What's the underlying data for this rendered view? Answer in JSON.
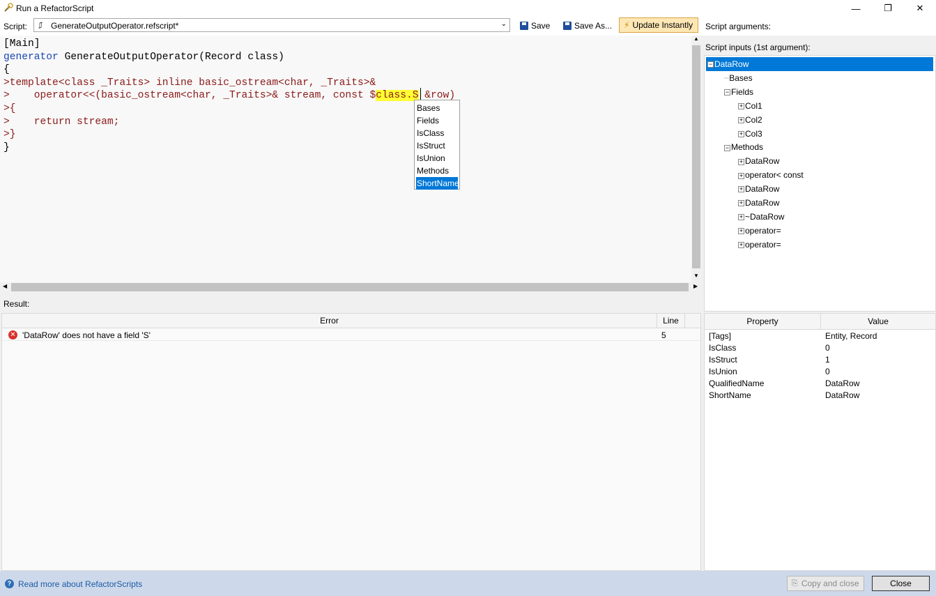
{
  "window": {
    "title": "Run a RefactorScript",
    "controls": {
      "minimize": "—",
      "restore": "❐",
      "close": "✕"
    }
  },
  "toolbar": {
    "script_label": "Script:",
    "script_value": "GenerateOutputOperator.refscript*",
    "save_label": "Save",
    "save_as_label": "Save As...",
    "update_label": "Update Instantly",
    "args_label": "Script arguments:"
  },
  "editor": {
    "lines": [
      {
        "parts": [
          {
            "t": "[Main]",
            "c": ""
          }
        ]
      },
      {
        "parts": [
          {
            "t": "generator",
            "c": "kw"
          },
          {
            "t": " GenerateOutputOperator(Record class)",
            "c": ""
          }
        ]
      },
      {
        "parts": [
          {
            "t": "{",
            "c": ""
          }
        ]
      },
      {
        "parts": [
          {
            "t": ">template<class _Traits> inline basic_ostream<char, _Traits>&",
            "c": "red"
          }
        ]
      },
      {
        "parts": [
          {
            "t": ">    operator<<(basic_ostream<char, _Traits>& stream, const $",
            "c": "red"
          },
          {
            "t": "class.S",
            "c": "red hl"
          },
          {
            "t": " &row)",
            "c": "red"
          }
        ]
      },
      {
        "parts": [
          {
            "t": ">{",
            "c": "red"
          }
        ]
      },
      {
        "parts": [
          {
            "t": ">    return stream;",
            "c": "red"
          }
        ]
      },
      {
        "parts": [
          {
            "t": ">}",
            "c": "red"
          }
        ]
      },
      {
        "parts": [
          {
            "t": "}",
            "c": ""
          }
        ]
      }
    ],
    "completion": [
      "Bases",
      "Fields",
      "IsClass",
      "IsStruct",
      "IsUnion",
      "Methods",
      "ShortName"
    ],
    "completion_selected": "ShortName"
  },
  "inputs": {
    "label": "Script inputs (1st argument):",
    "tree": [
      {
        "label": "DataRow",
        "depth": 0,
        "exp": "−",
        "selected": true
      },
      {
        "label": "Bases",
        "depth": 1,
        "exp": ""
      },
      {
        "label": "Fields",
        "depth": 1,
        "exp": "−"
      },
      {
        "label": "Col1",
        "depth": 2,
        "exp": "+"
      },
      {
        "label": "Col2",
        "depth": 2,
        "exp": "+"
      },
      {
        "label": "Col3",
        "depth": 2,
        "exp": "+"
      },
      {
        "label": "Methods",
        "depth": 1,
        "exp": "−"
      },
      {
        "label": "DataRow",
        "depth": 2,
        "exp": "+"
      },
      {
        "label": "operator< const",
        "depth": 2,
        "exp": "+"
      },
      {
        "label": "DataRow",
        "depth": 2,
        "exp": "+"
      },
      {
        "label": "DataRow",
        "depth": 2,
        "exp": "+"
      },
      {
        "label": "~DataRow",
        "depth": 2,
        "exp": "+"
      },
      {
        "label": "operator=",
        "depth": 2,
        "exp": "+"
      },
      {
        "label": "operator=",
        "depth": 2,
        "exp": "+"
      }
    ]
  },
  "result": {
    "label": "Result:",
    "columns": {
      "error": "Error",
      "line": "Line"
    },
    "errors": [
      {
        "message": "'DataRow' does not have a field 'S'",
        "line": "5"
      }
    ]
  },
  "properties": {
    "columns": {
      "property": "Property",
      "value": "Value"
    },
    "rows": [
      {
        "k": "[Tags]",
        "v": "Entity, Record"
      },
      {
        "k": "IsClass",
        "v": "0"
      },
      {
        "k": "IsStruct",
        "v": "1"
      },
      {
        "k": "IsUnion",
        "v": "0"
      },
      {
        "k": "QualifiedName",
        "v": "DataRow"
      },
      {
        "k": "ShortName",
        "v": "DataRow"
      }
    ]
  },
  "footer": {
    "help_link": "Read more about RefactorScripts",
    "copy_close": "Copy and close",
    "close": "Close"
  },
  "colors": {
    "accent": "#0078d7",
    "keyword": "#1a48b5",
    "template_text": "#8b1a1a",
    "highlight": "#ffff33",
    "error": "#d9302b"
  }
}
